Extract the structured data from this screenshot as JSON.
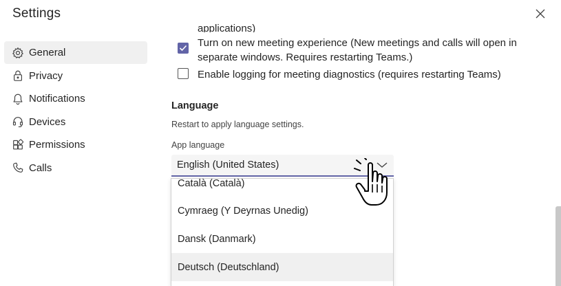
{
  "window": {
    "title": "Settings"
  },
  "sidebar": {
    "items": [
      {
        "label": "General",
        "icon": "gear-icon",
        "active": true
      },
      {
        "label": "Privacy",
        "icon": "lock-icon"
      },
      {
        "label": "Notifications",
        "icon": "bell-icon"
      },
      {
        "label": "Devices",
        "icon": "headset-icon"
      },
      {
        "label": "Permissions",
        "icon": "apps-icon"
      },
      {
        "label": "Calls",
        "icon": "phone-icon"
      }
    ]
  },
  "content": {
    "clipped_text": "applications)",
    "options": [
      {
        "label": "Turn on new meeting experience (New meetings and calls will open in separate windows. Requires restarting Teams.)",
        "checked": true
      },
      {
        "label": "Enable logging for meeting diagnostics (requires restarting Teams)",
        "checked": false
      }
    ],
    "language": {
      "title": "Language",
      "description": "Restart to apply language settings.",
      "field_label": "App language",
      "selected": "English (United States)",
      "options": [
        "Català (Català)",
        "Cymraeg (Y Deyrnas Unedig)",
        "Dansk (Danmark)",
        "Deutsch (Deutschland)"
      ],
      "hovered_option": "Deutsch (Deutschland)"
    }
  },
  "colors": {
    "accent": "#6264a7",
    "active_bg": "#f0f0f0",
    "text": "#242424"
  }
}
